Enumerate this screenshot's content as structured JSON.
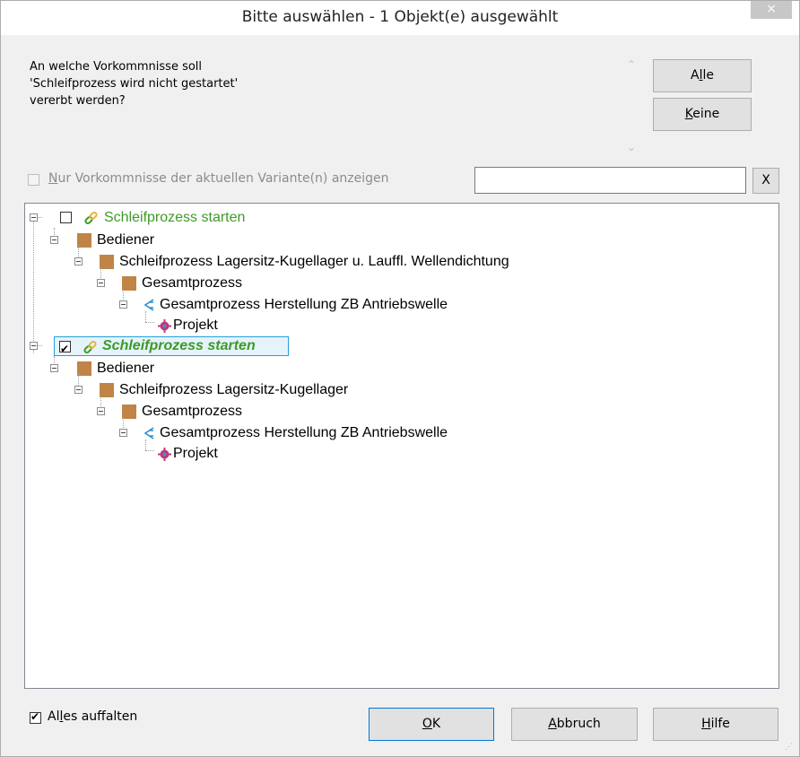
{
  "window": {
    "title": "Bitte auswählen - 1 Objekt(e) ausgewählt",
    "close_label": "×"
  },
  "prompt": {
    "lines": [
      "An welche Vorkommnisse soll",
      "'Schleifprozess wird nicht gestartet'",
      "vererbt werden?"
    ]
  },
  "buttons": {
    "alle_pre": "A",
    "alle_u": "l",
    "alle_post": "le",
    "keine_u": "K",
    "keine_post": "eine",
    "x_label": "X",
    "ok_u": "O",
    "ok_post": "K",
    "abbruch_u": "A",
    "abbruch_post": "bbruch",
    "hilfe_u": "H",
    "hilfe_post": "ilfe"
  },
  "filter": {
    "checked": false,
    "label_u": "N",
    "label_post": "ur Vorkommnisse der aktuellen Variante(n) anzeigen",
    "search_value": ""
  },
  "tree": {
    "nodes": [
      {
        "label": "Schleifprozess starten",
        "type": "link",
        "checked": false,
        "selected": false
      },
      {
        "label": "Bediener",
        "type": "square"
      },
      {
        "label": "Schleifprozess Lagersitz-Kugellager u. Laeuffl. Wellendichtung",
        "display": "Schleifprozess Lagersitz-Kugellager u. Laufﬂ. Wellendichtung",
        "type": "square"
      },
      {
        "label": "Gesamtprozess",
        "type": "square"
      },
      {
        "label": "Gesamtprozess Herstellung ZB Antriebswelle",
        "type": "process"
      },
      {
        "label": "Projekt",
        "type": "project"
      },
      {
        "label": "Schleifprozess starten",
        "type": "link",
        "checked": true,
        "selected": true
      },
      {
        "label": "Bediener",
        "type": "square"
      },
      {
        "label": "Schleifprozess Lagersitz-Kugellager",
        "type": "square"
      },
      {
        "label": "Gesamtprozess",
        "type": "square"
      },
      {
        "label": "Gesamtprozess Herstellung ZB Antriebswelle",
        "type": "process"
      },
      {
        "label": "Projekt",
        "type": "project"
      }
    ]
  },
  "expand_all": {
    "checked": true,
    "label_pre": "Al",
    "label_u": "l",
    "label_post": "es auffalten"
  },
  "colors": {
    "green": "#3d9a26",
    "brown": "#c08447",
    "selection": "#26a0da"
  }
}
